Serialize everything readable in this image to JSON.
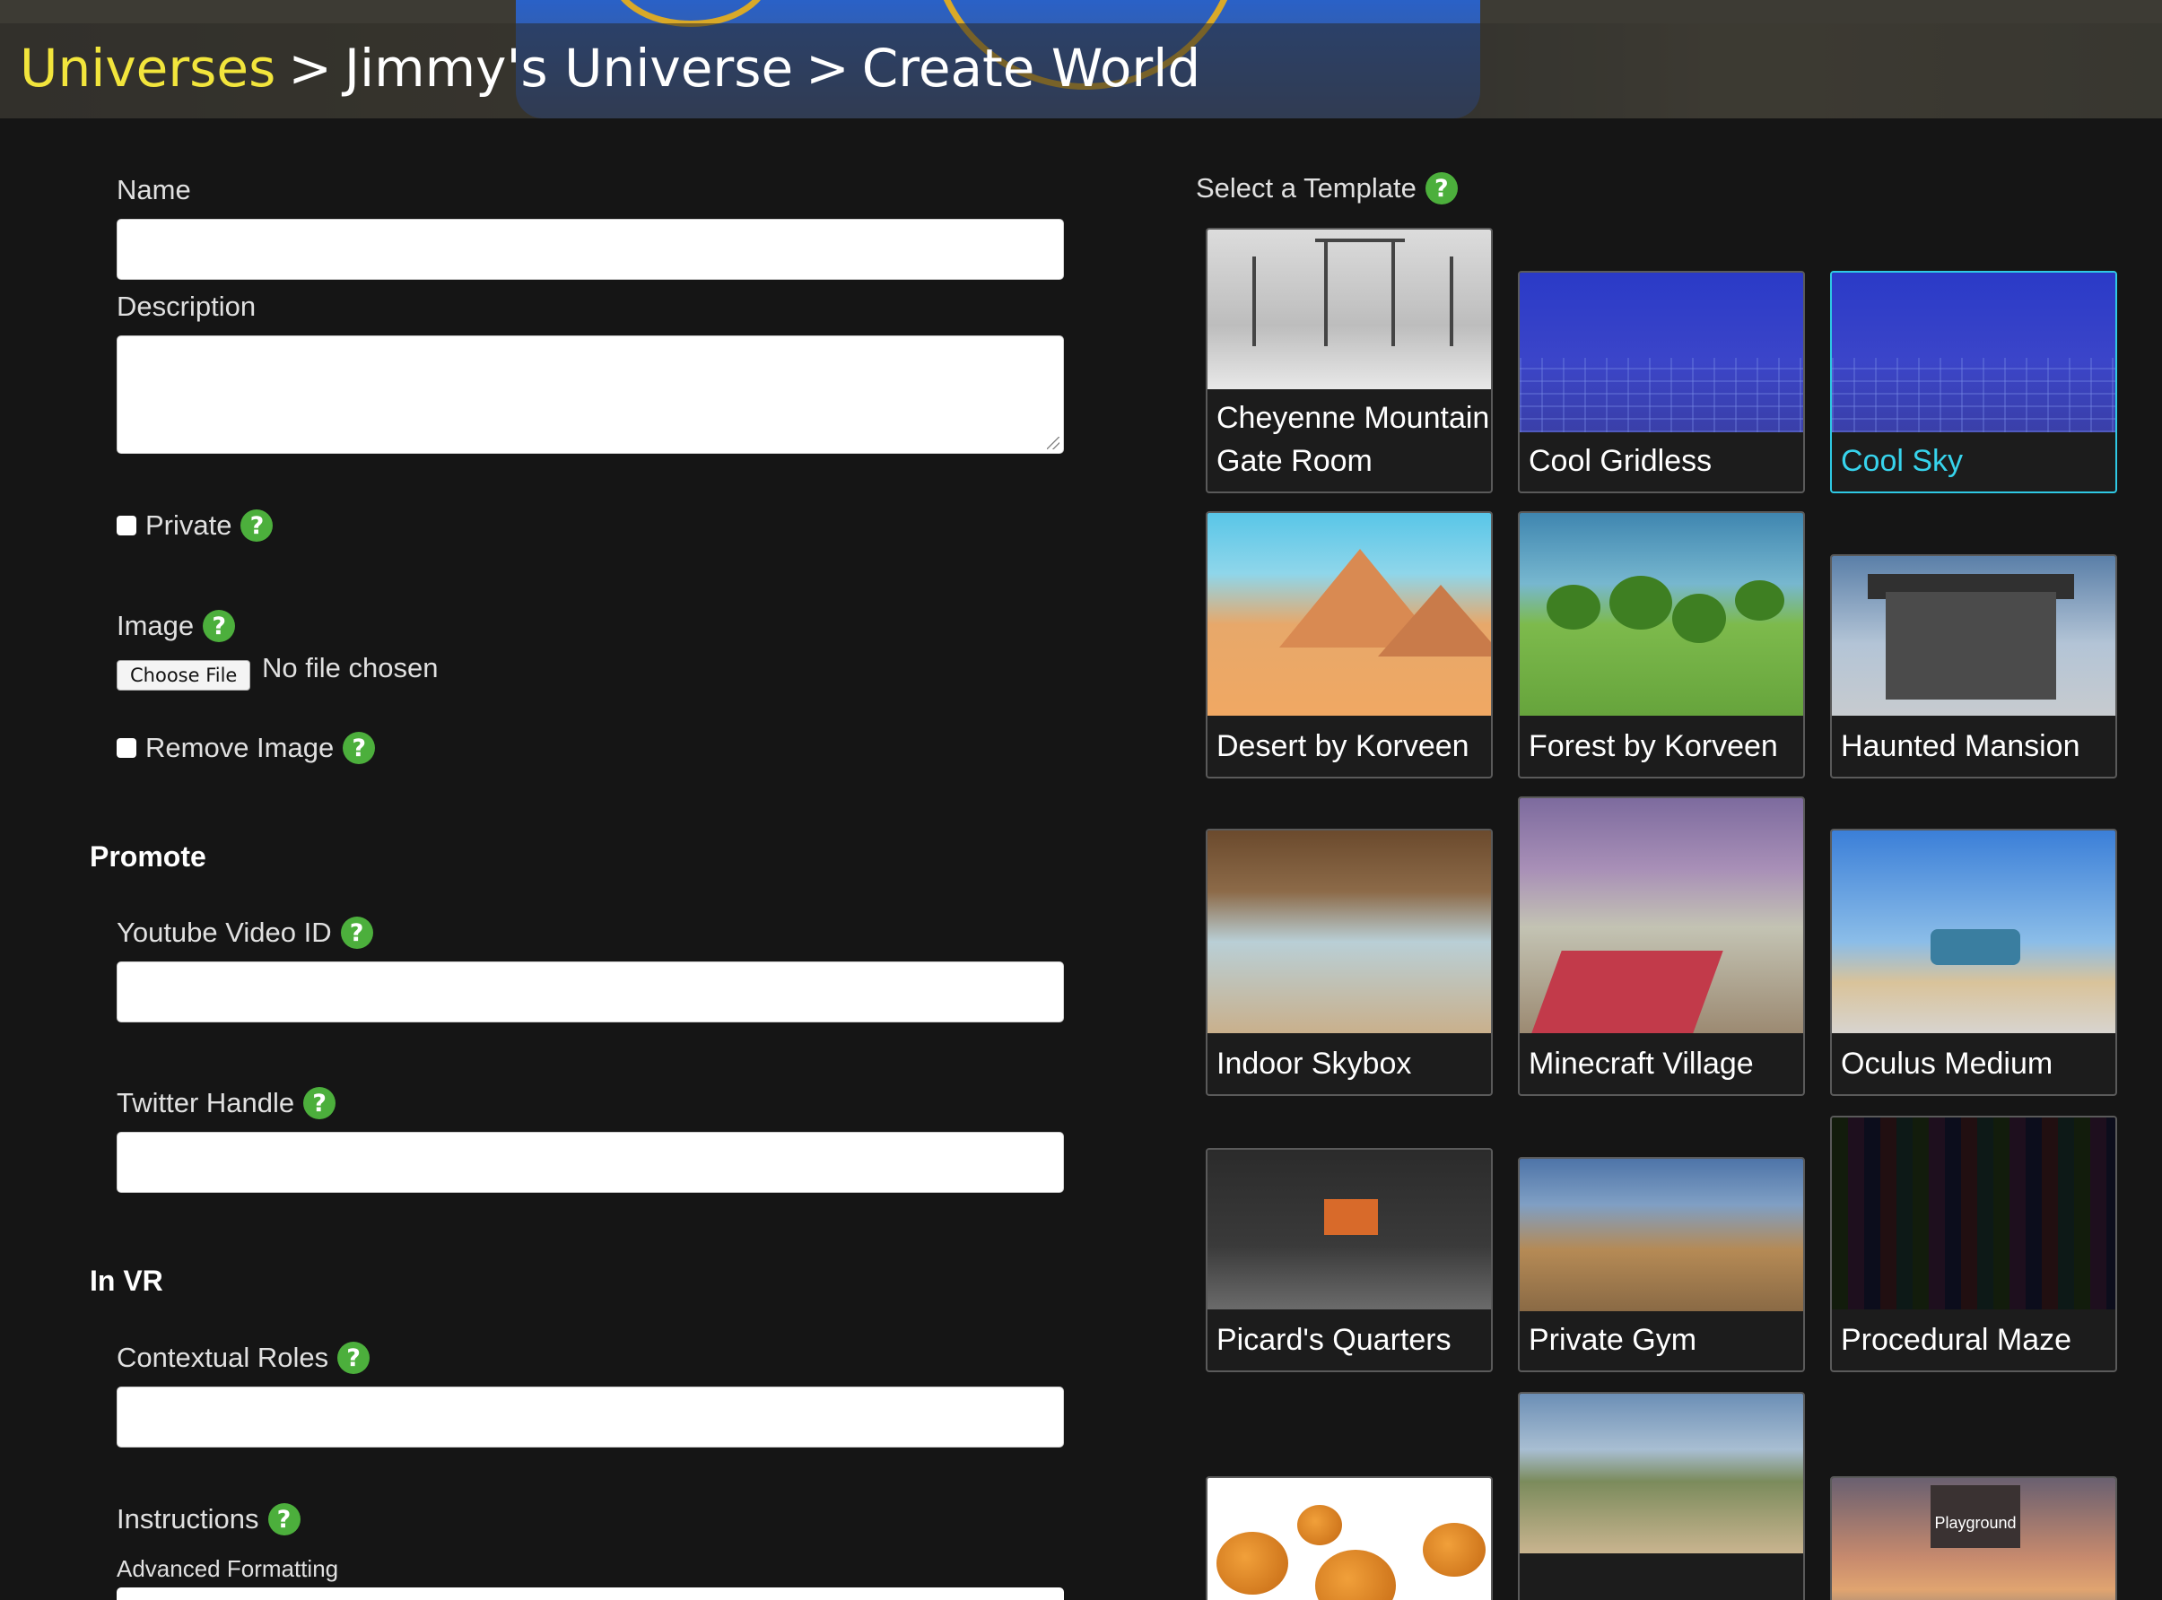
{
  "breadcrumb": {
    "universes": "Universes",
    "universe": "Jimmy's Universe",
    "current": "Create World",
    "separator": ">"
  },
  "form": {
    "name_label": "Name",
    "name_value": "",
    "description_label": "Description",
    "description_value": "",
    "private_label": "Private",
    "private_checked": false,
    "image_label": "Image",
    "choose_file_label": "Choose File",
    "file_status": "No file chosen",
    "remove_image_label": "Remove Image",
    "remove_image_checked": false,
    "promote_heading": "Promote",
    "youtube_label": "Youtube Video ID",
    "youtube_value": "",
    "twitter_label": "Twitter Handle",
    "twitter_value": "",
    "invr_heading": "In VR",
    "roles_label": "Contextual Roles",
    "roles_value": "",
    "instructions_label": "Instructions",
    "advanced_formatting_label": "Advanced Formatting"
  },
  "help_icon": "?",
  "templates": {
    "label": "Select a Template",
    "selected": "Cool Sky",
    "items": [
      {
        "name_line1": "Cheyenne Mountain",
        "name_line2": "Gate Room"
      },
      {
        "name": "Cool Gridless"
      },
      {
        "name": "Cool Sky"
      },
      {
        "name": "Desert by Korveen"
      },
      {
        "name": "Forest by Korveen"
      },
      {
        "name": "Haunted Mansion"
      },
      {
        "name": "Indoor Skybox"
      },
      {
        "name": "Minecraft Village"
      },
      {
        "name": "Oculus Medium"
      },
      {
        "name": "Picard's Quarters"
      },
      {
        "name": "Private Gym"
      },
      {
        "name": "Procedural Maze"
      },
      {
        "name": ""
      },
      {
        "name": ""
      },
      {
        "name": "",
        "thumb_text": "Playground"
      }
    ]
  },
  "colors": {
    "accent_link": "#f2e53c",
    "help_badge": "#4caf3c",
    "selected_tile": "#2fc9e4",
    "background": "#151515"
  }
}
